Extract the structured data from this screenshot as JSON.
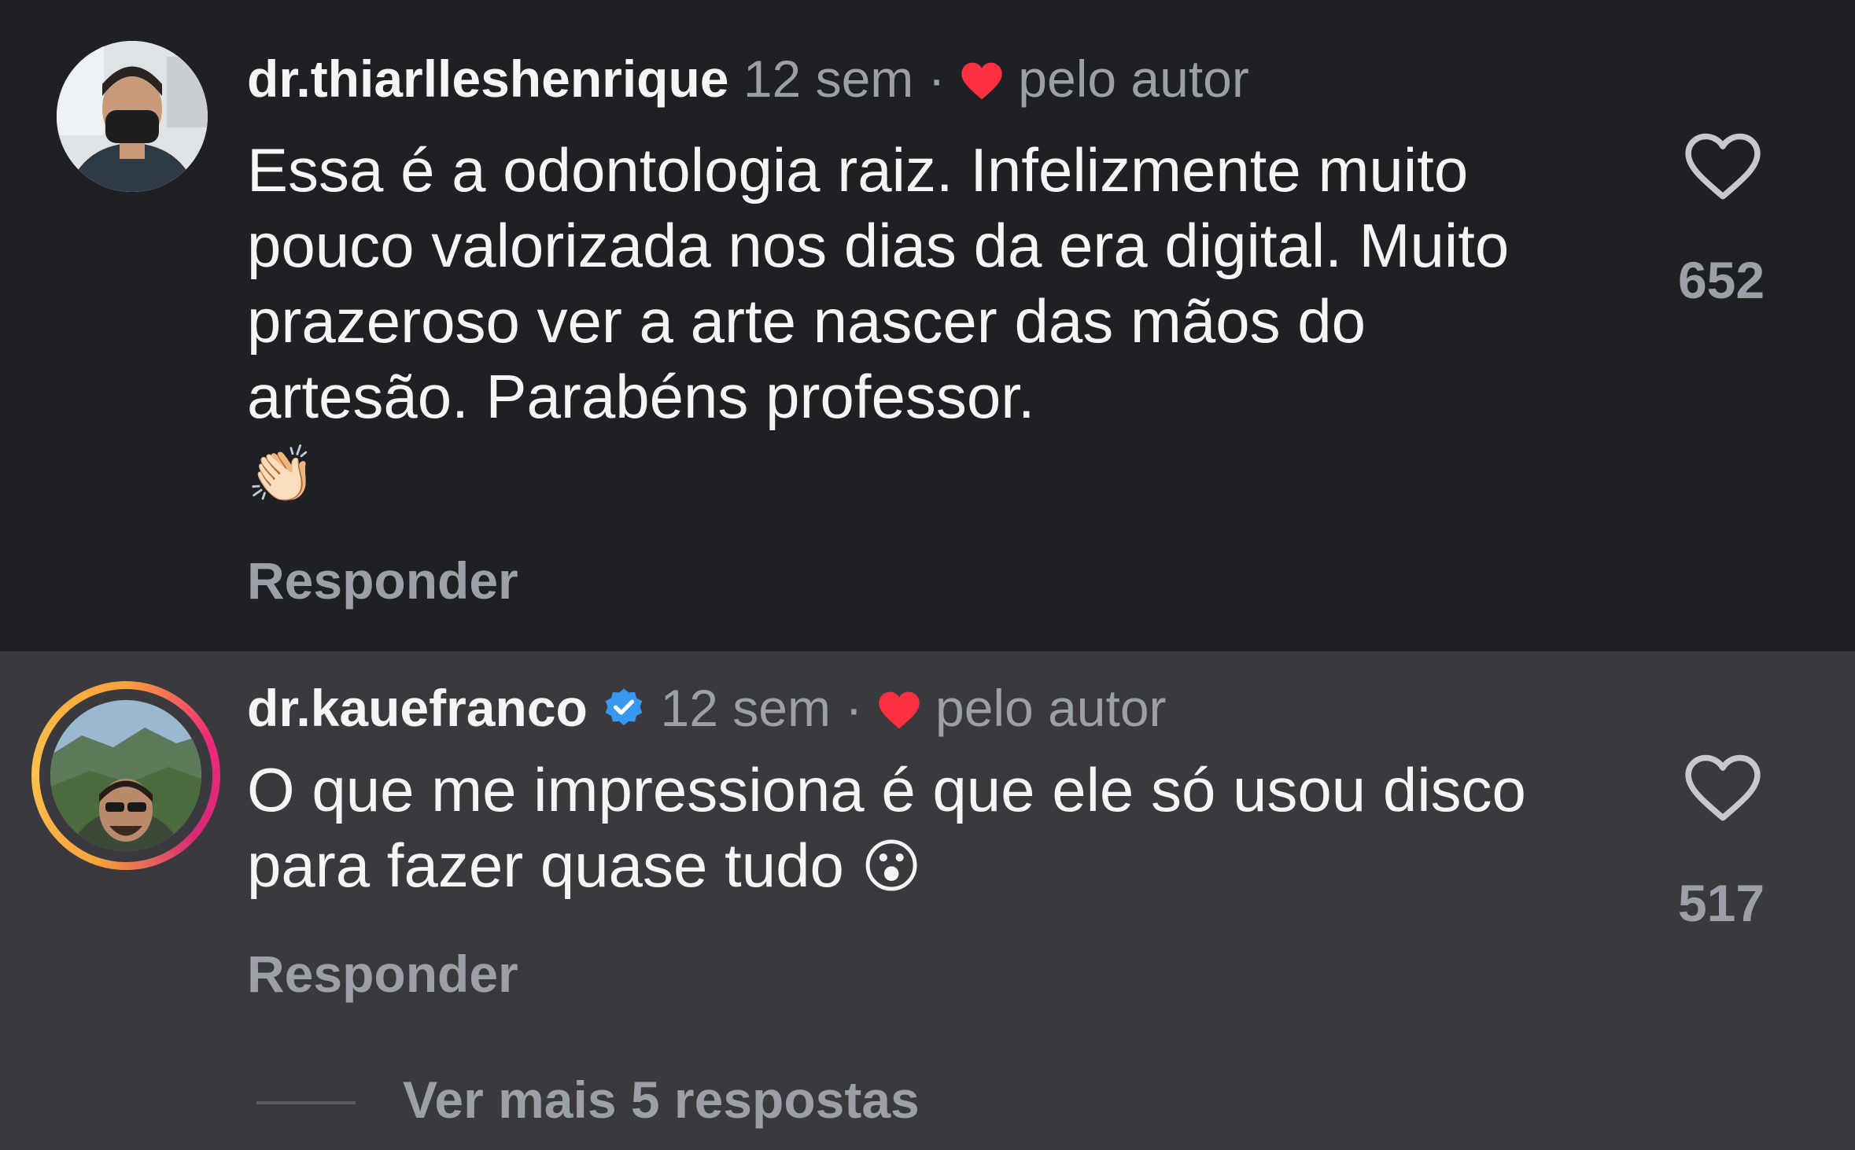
{
  "comments": [
    {
      "username": "dr.thiarlleshenrique",
      "time": "12 sem",
      "separator": "·",
      "liked_by_author": "pelo autor",
      "text": "Essa é a odontologia raiz. Infelizmente muito pouco valorizada nos dias da era digital. Muito prazeroso ver a arte nascer das mãos do artesão. Parabéns professor.",
      "emoji": "👏🏻",
      "reply_label": "Responder",
      "likes": "652",
      "verified": false
    },
    {
      "username": "dr.kauefranco",
      "time": "12 sem",
      "separator": "·",
      "liked_by_author": "pelo autor",
      "text": "O que me impressiona é que ele só usou disco para fazer quase tudo",
      "emoji": "😮",
      "reply_label": "Responder",
      "likes": "517",
      "verified": true
    }
  ],
  "more_replies": "Ver mais 5 respostas",
  "colors": {
    "heart": "#ff3040",
    "verified": "#3897f0",
    "muted": "#9aa0a6",
    "bg_first": "#1f2024",
    "bg_highlight": "#3a3a3e"
  },
  "icons": [
    "heart-icon",
    "verified-badge-icon",
    "like-outline-icon"
  ]
}
